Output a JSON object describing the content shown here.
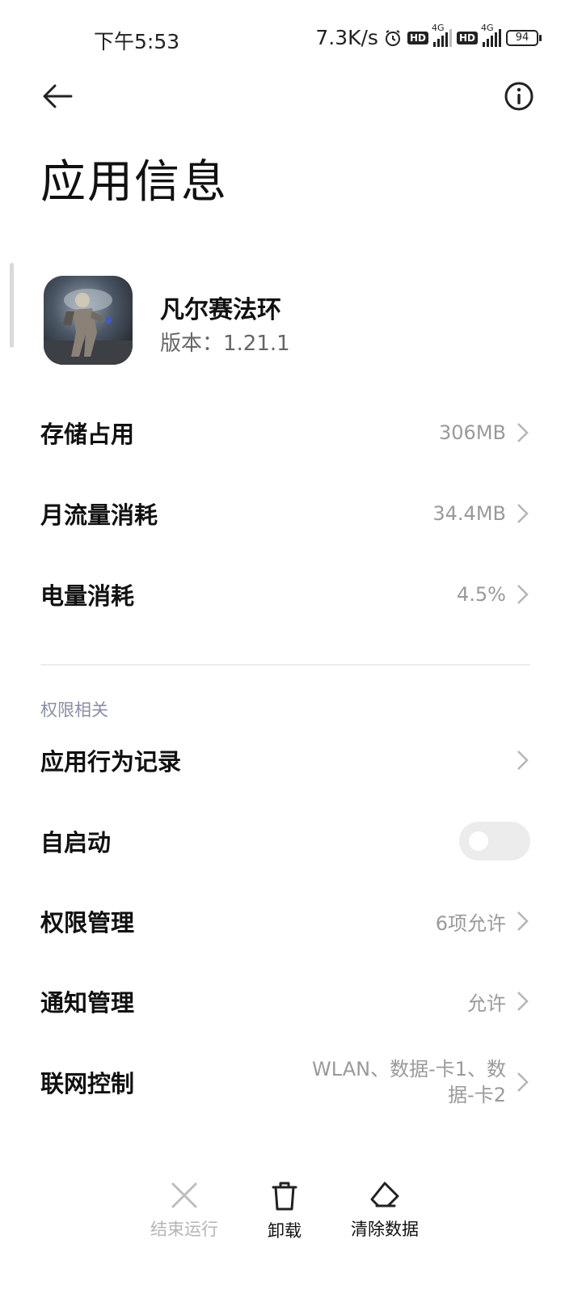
{
  "status_bar": {
    "time": "下午5:53",
    "net_speed": "7.3K/s",
    "hd1": "HD",
    "net1": "4G",
    "hd2": "HD",
    "net2": "4G",
    "battery": "94"
  },
  "header": {
    "back_icon": "arrow-left-icon",
    "info_icon": "info-circle-icon",
    "title": "应用信息"
  },
  "app": {
    "name": "凡尔赛法环",
    "version": "版本：1.21.1"
  },
  "rows": {
    "storage": {
      "label": "存储占用",
      "value": "306MB"
    },
    "traffic": {
      "label": "月流量消耗",
      "value": "34.4MB"
    },
    "battery": {
      "label": "电量消耗",
      "value": "4.5%"
    }
  },
  "permissions": {
    "section_title": "权限相关",
    "behavior": {
      "label": "应用行为记录"
    },
    "autostart": {
      "label": "自启动",
      "enabled": false
    },
    "perm_manage": {
      "label": "权限管理",
      "value": "6项允许"
    },
    "notify": {
      "label": "通知管理",
      "value": "允许"
    },
    "network": {
      "label": "联网控制",
      "value_line1": "WLAN、数据-卡1、数",
      "value_line2": "据-卡2"
    }
  },
  "bottom_bar": {
    "stop": {
      "label": "结束运行",
      "icon": "close-icon"
    },
    "uninstall": {
      "label": "卸载",
      "icon": "trash-icon"
    },
    "clear": {
      "label": "清除数据",
      "icon": "eraser-icon"
    }
  },
  "colors": {
    "section_title": "#8a8fa6",
    "secondary_text": "#9a9a9a",
    "toggle_off": "#ececec"
  }
}
